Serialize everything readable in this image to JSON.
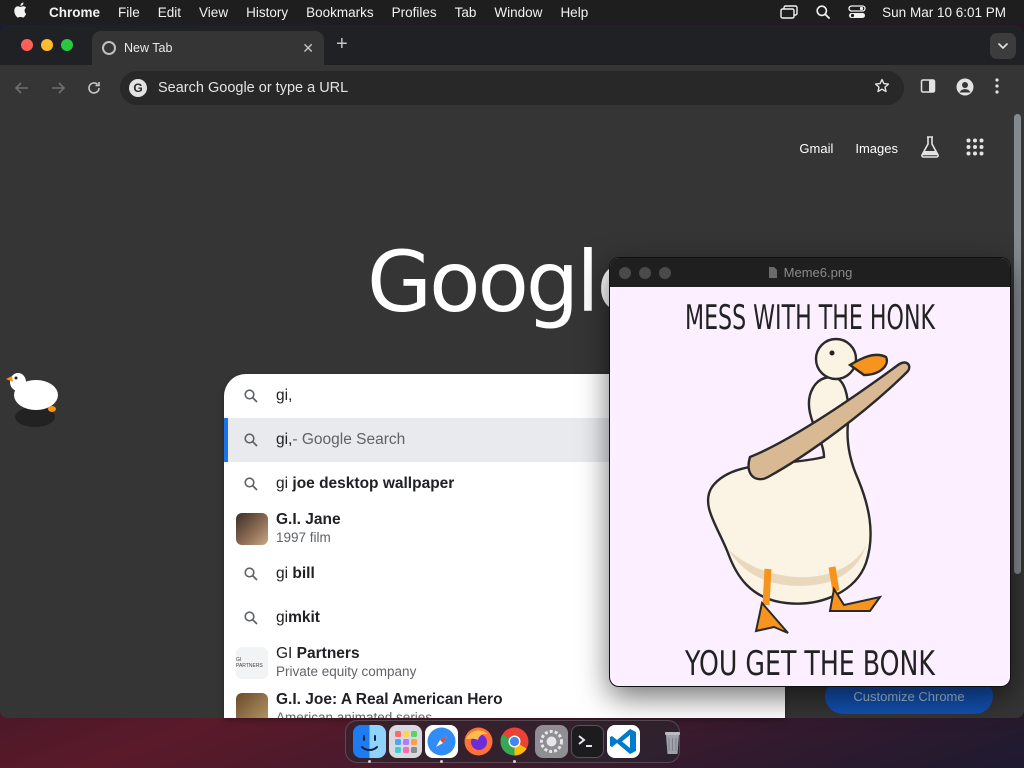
{
  "menubar": {
    "app_name": "Chrome",
    "items": [
      "File",
      "Edit",
      "View",
      "History",
      "Bookmarks",
      "Profiles",
      "Tab",
      "Window",
      "Help"
    ],
    "clock": "Sun Mar 10  6:01 PM"
  },
  "chrome": {
    "tab_title": "New Tab",
    "omnibox_placeholder": "Search Google or type a URL",
    "ntp_links": {
      "gmail": "Gmail",
      "images": "Images"
    },
    "google_logo": "Google",
    "customize_label": "Customize Chrome"
  },
  "dropdown": {
    "query": "gi,",
    "suggestions": [
      {
        "match": "gi,",
        "rest": " - Google Search",
        "active": true
      },
      {
        "match": "gi",
        "rest": " joe desktop wallpaper"
      },
      {
        "title": "G.I. Jane",
        "subtitle": "1997 film",
        "thumb": "jane"
      },
      {
        "match": "gi",
        "rest": " bill"
      },
      {
        "match": "gi",
        "rest": "mkit"
      },
      {
        "match": "GI",
        "rest": " Partners",
        "subtitle": "Private equity company",
        "thumb": "partners"
      },
      {
        "title": "G.I. Joe: A Real American Hero",
        "subtitle": "American animated series",
        "thumb": "gijoe"
      }
    ],
    "partners_logo_text": "GI PARTNERS"
  },
  "preview": {
    "filename": "Meme6.png",
    "top_text": "MESS WITH THE HONK",
    "bottom_text": "YOU GET THE BONK"
  },
  "dock": {
    "apps": [
      {
        "name": "finder",
        "running": true
      },
      {
        "name": "launchpad",
        "running": false
      },
      {
        "name": "safari",
        "running": true
      },
      {
        "name": "firefox",
        "running": false
      },
      {
        "name": "chrome",
        "running": true
      },
      {
        "name": "system-settings",
        "running": false
      },
      {
        "name": "terminal",
        "running": false
      },
      {
        "name": "vscode",
        "running": false
      }
    ]
  },
  "colors": {
    "chrome_bg": "#353535",
    "tabstrip_bg": "#202124",
    "omnibox_bg": "#282828",
    "accent_blue": "#1a73e8",
    "meme_bg": "#fcefff",
    "goose_orange": "#f7941d"
  }
}
